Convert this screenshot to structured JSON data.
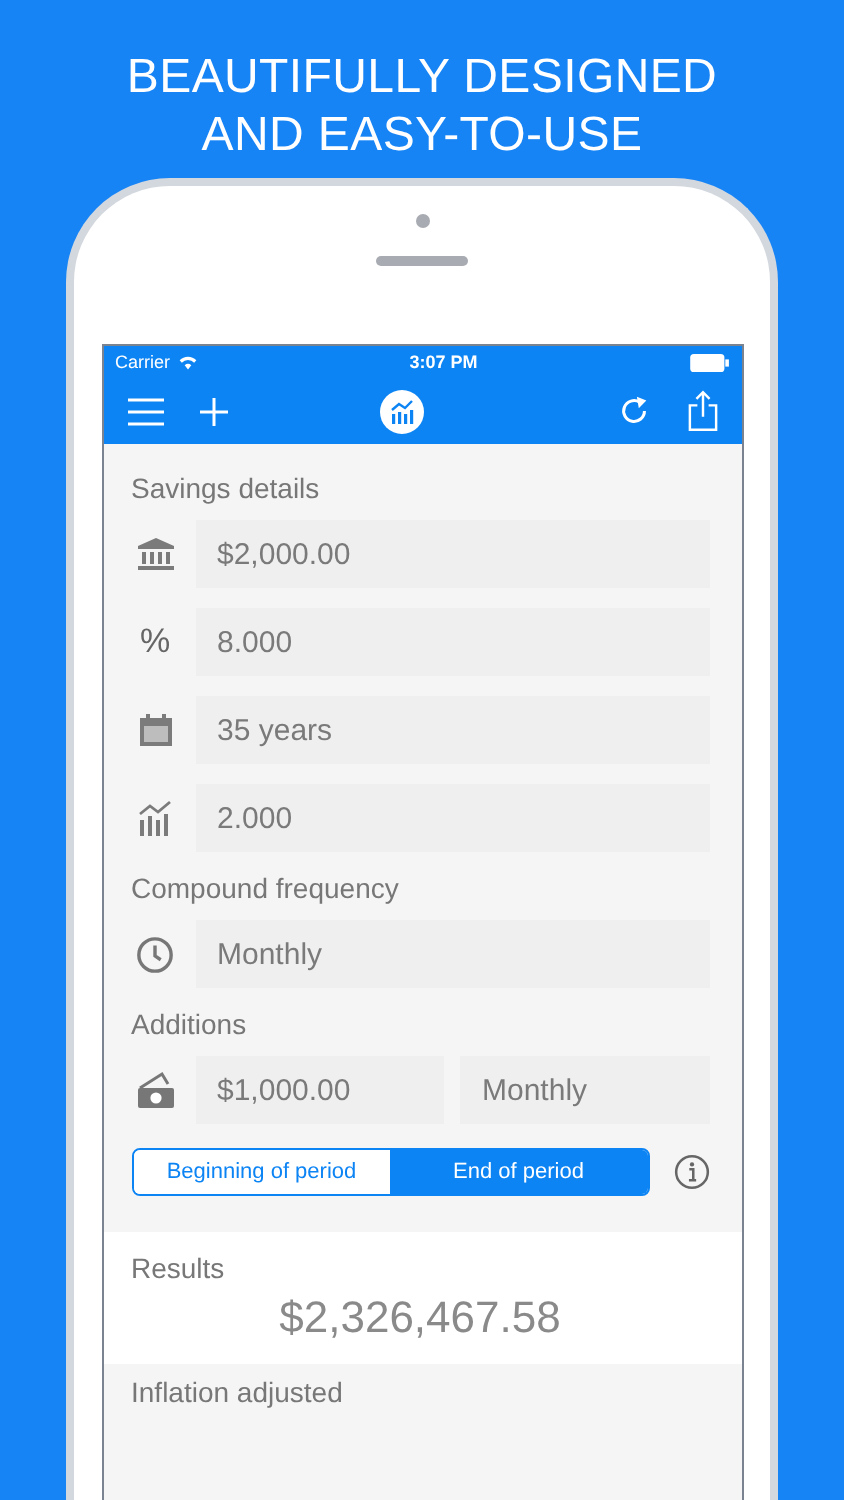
{
  "headline": [
    "BEAUTIFULLY DESIGNED",
    "AND EASY-TO-USE"
  ],
  "status_bar": {
    "carrier": "Carrier",
    "time": "3:07 PM"
  },
  "savings_details": {
    "title": "Savings details",
    "fields": [
      {
        "value": "$2,000.00"
      },
      {
        "symbol": "%",
        "value": "8.000"
      },
      {
        "value": "35 years"
      },
      {
        "value": "2.000"
      }
    ]
  },
  "compound_frequency": {
    "title": "Compound frequency",
    "value": "Monthly"
  },
  "additions": {
    "title": "Additions",
    "amount": "$1,000.00",
    "frequency": "Monthly",
    "timing": [
      {
        "label": "Beginning of period",
        "selected": false
      },
      {
        "label": "End of period",
        "selected": true
      }
    ]
  },
  "results": {
    "title": "Results",
    "value": "$2,326,467.58"
  },
  "inflation_adjusted": {
    "title": "Inflation adjusted"
  }
}
